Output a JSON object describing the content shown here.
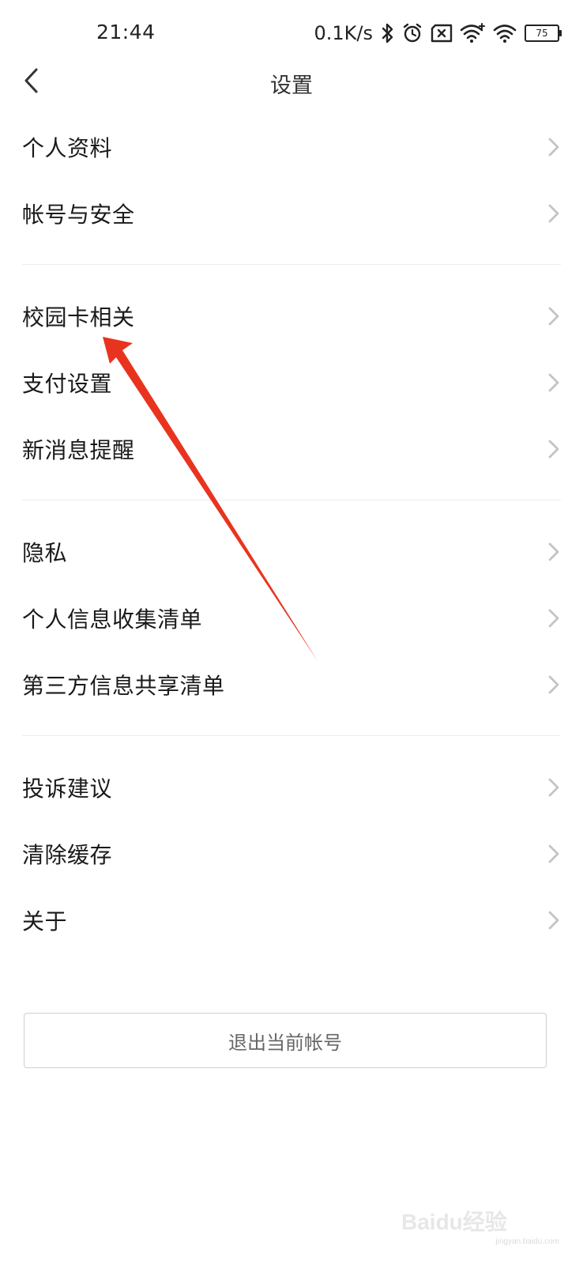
{
  "status_bar": {
    "time": "21:44",
    "net_speed": "0.1K/s",
    "battery_level": "75",
    "icons": [
      "bluetooth-icon",
      "alarm-icon",
      "sim-blocked-icon",
      "wifi-plus-icon",
      "wifi-icon",
      "battery-icon"
    ]
  },
  "header": {
    "title": "设置",
    "back_icon": "chevron-left-icon"
  },
  "groups": [
    {
      "items": [
        {
          "label": "个人资料"
        },
        {
          "label": "帐号与安全"
        }
      ]
    },
    {
      "items": [
        {
          "label": "校园卡相关"
        },
        {
          "label": "支付设置"
        },
        {
          "label": "新消息提醒"
        }
      ]
    },
    {
      "items": [
        {
          "label": "隐私"
        },
        {
          "label": "个人信息收集清单"
        },
        {
          "label": "第三方信息共享清单"
        }
      ]
    },
    {
      "items": [
        {
          "label": "投诉建议"
        },
        {
          "label": "清除缓存"
        },
        {
          "label": "关于"
        }
      ]
    }
  ],
  "logout": {
    "label": "退出当前帐号"
  },
  "watermark": {
    "brand": "Baidu经验",
    "url": "jingyan.baidu.com"
  },
  "colors": {
    "arrow": "#e8341f",
    "chevron": "#c4c4c4",
    "divider": "#ececec",
    "logout_border": "#cfcfcf"
  }
}
